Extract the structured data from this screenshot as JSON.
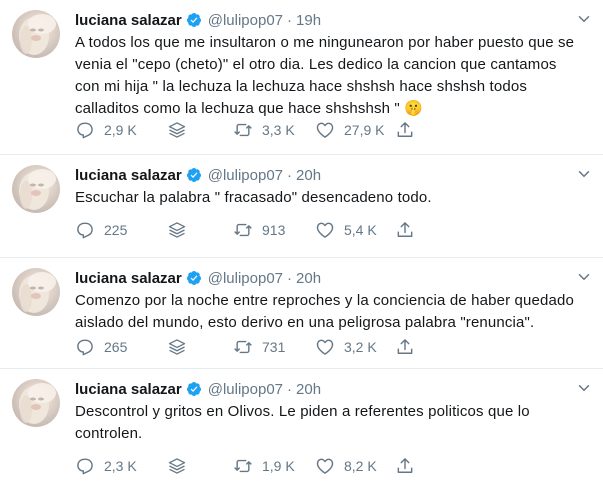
{
  "colors": {
    "text": "#14171a",
    "muted": "#657786",
    "verified": "#1da1f2",
    "divider": "#e6ecf0"
  },
  "icons": {
    "avatar": "profile-photo",
    "verified": "verified-badge-icon",
    "caret": "chevron-down-icon",
    "reply": "reply-icon",
    "stack": "stack-icon",
    "retweet": "retweet-icon",
    "like": "heart-icon",
    "share": "share-icon"
  },
  "tweets": [
    {
      "name": "luciana salazar",
      "handle": "@lulipop07",
      "dot": "·",
      "time": "19h",
      "text": "A todos los que me insultaron o me ningunearon por haber puesto que se venia el \"cepo (cheto)\" el otro dia. Les dedico la cancion que cantamos con mi hija \" la lechuza la lechuza hace shshsh hace shshsh todos calladitos como la lechuza que hace shshshsh \" 🤫",
      "replies": "2,9 K",
      "retweets": "3,3 K",
      "likes": "27,9 K"
    },
    {
      "name": "luciana salazar",
      "handle": "@lulipop07",
      "dot": "·",
      "time": "20h",
      "text": "Escuchar la palabra \" fracasado\" desencadeno todo.",
      "replies": "225",
      "retweets": "913",
      "likes": "5,4 K"
    },
    {
      "name": "luciana salazar",
      "handle": "@lulipop07",
      "dot": "·",
      "time": "20h",
      "text": "Comenzo por la noche entre reproches y la conciencia de haber quedado aislado del mundo, esto derivo en una peligrosa palabra \"renuncia\".",
      "replies": "265",
      "retweets": "731",
      "likes": "3,2 K"
    },
    {
      "name": "luciana salazar",
      "handle": "@lulipop07",
      "dot": "·",
      "time": "20h",
      "text": "Descontrol y gritos en Olivos. Le piden a referentes politicos que lo controlen.",
      "replies": "2,3 K",
      "retweets": "1,9 K",
      "likes": "8,2 K"
    }
  ]
}
